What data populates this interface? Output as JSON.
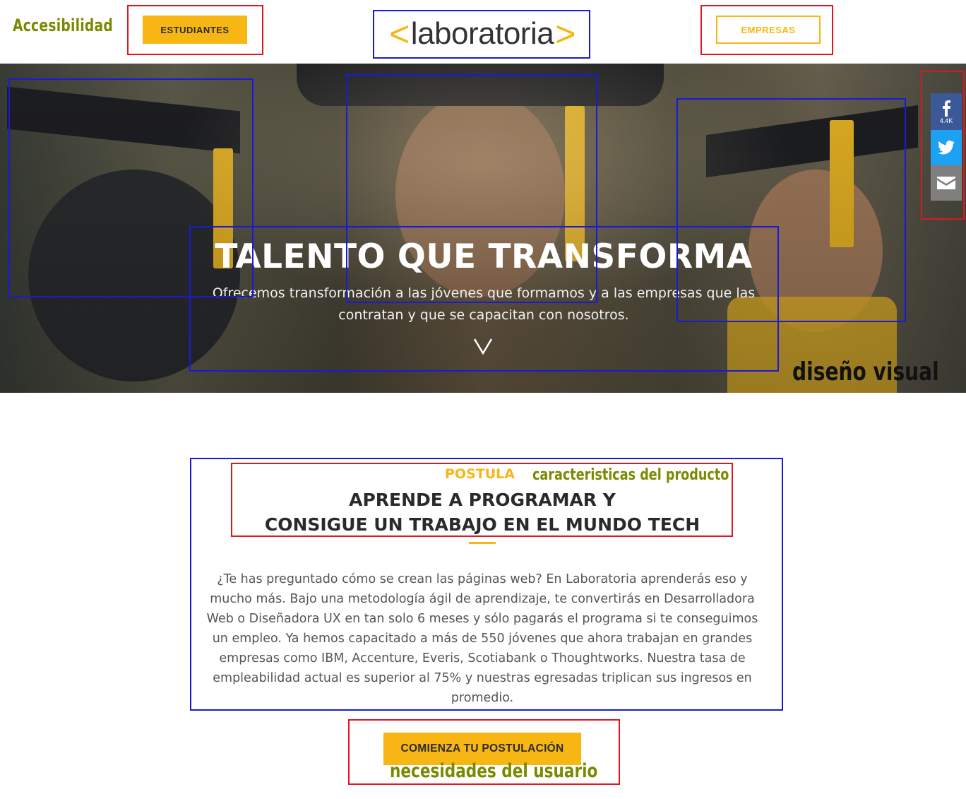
{
  "annotations": {
    "accesibilidad": "Accesibilidad",
    "diseno_visual": "diseño visual",
    "caracteristicas": "caracteristicas del producto",
    "necesidades": "necesidades del usuario"
  },
  "header": {
    "estudiantes_label": "ESTUDIANTES",
    "empresas_label": "EMPRESAS",
    "logo": {
      "left_chevron": "<",
      "word": "laboratoria",
      "right_chevron": ">"
    }
  },
  "hero": {
    "title": "TALENTO QUE TRANSFORMA",
    "subtitle": "Ofrecemos transformación a las jóvenes que formamos y a las empresas que las contratan y que se capacitan con nosotros.",
    "scroll_icon": "chevron-down-icon"
  },
  "share": {
    "facebook_count": "4.4K",
    "icons": [
      "facebook-icon",
      "twitter-icon",
      "email-icon"
    ]
  },
  "content": {
    "eyebrow": "POSTULA",
    "title_line1": "APRENDE A PROGRAMAR Y",
    "title_line2": "CONSIGUE UN TRABAJO EN EL MUNDO TECH",
    "body": "¿Te has preguntado cómo se crean las páginas web? En Laboratoria aprenderás eso y mucho más. Bajo una metodología ágil de aprendizaje, te convertirás en Desarrolladora Web o Diseñadora UX en tan solo 6 meses y sólo pagarás el programa si te conseguimos un empleo. Ya hemos capacitado a más de 550 jóvenes que ahora trabajan en grandes empresas como IBM, Accenture, Everis, Scotiabank o Thoughtworks. Nuestra tasa de empleabilidad actual es superior al 75% y nuestras egresadas triplican sus ingresos en promedio.",
    "cta_label": "COMIENZA TU POSTULACIÓN"
  },
  "colors": {
    "accent": "#f7b614",
    "annotation_red": "#e0161e",
    "annotation_blue": "#1a1ad6",
    "annotation_olive": "#7a8a00",
    "facebook": "#3b5998",
    "twitter": "#1da1f2",
    "email": "#7f7f7f"
  }
}
